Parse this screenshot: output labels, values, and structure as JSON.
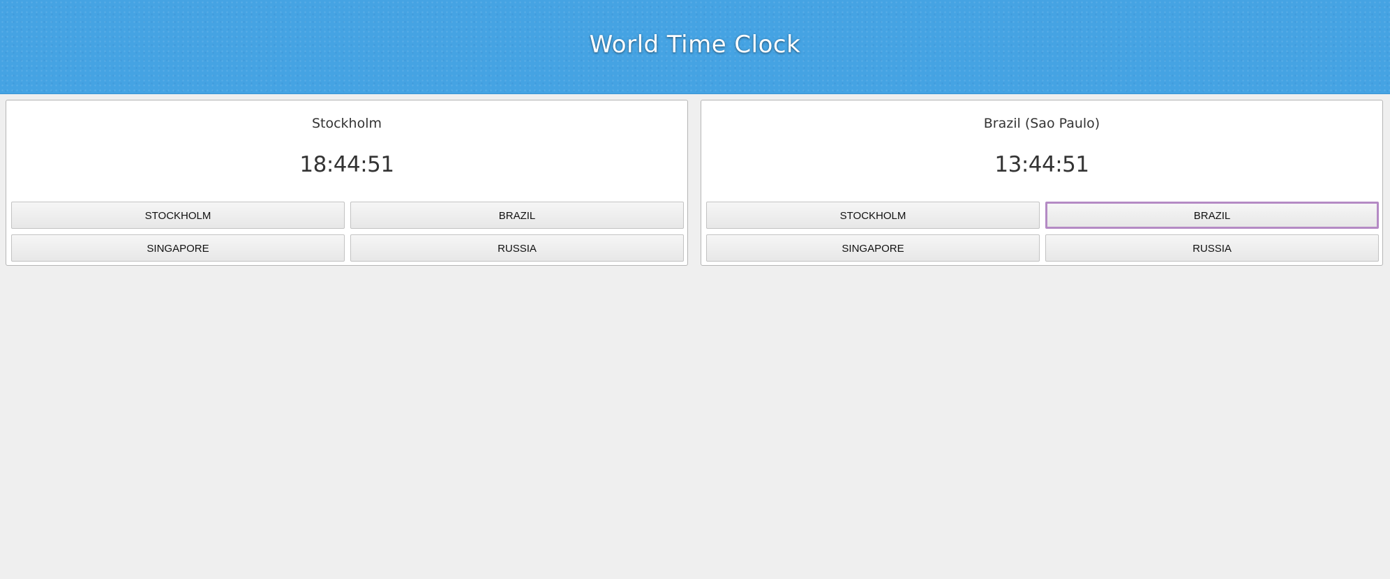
{
  "header": {
    "title": "World Time Clock"
  },
  "panels": [
    {
      "city": "Stockholm",
      "time": "18:44:51",
      "buttons": [
        "STOCKHOLM",
        "BRAZIL",
        "SINGAPORE",
        "RUSSIA"
      ]
    },
    {
      "city": "Brazil (Sao Paulo)",
      "time": "13:44:51",
      "buttons": [
        "STOCKHOLM",
        "BRAZIL",
        "SINGAPORE",
        "RUSSIA"
      ],
      "focused_button": "BRAZIL"
    }
  ],
  "colors": {
    "header_bg": "#45a3e3",
    "page_bg": "#efefef",
    "focus_outline": "#b48ac4"
  }
}
